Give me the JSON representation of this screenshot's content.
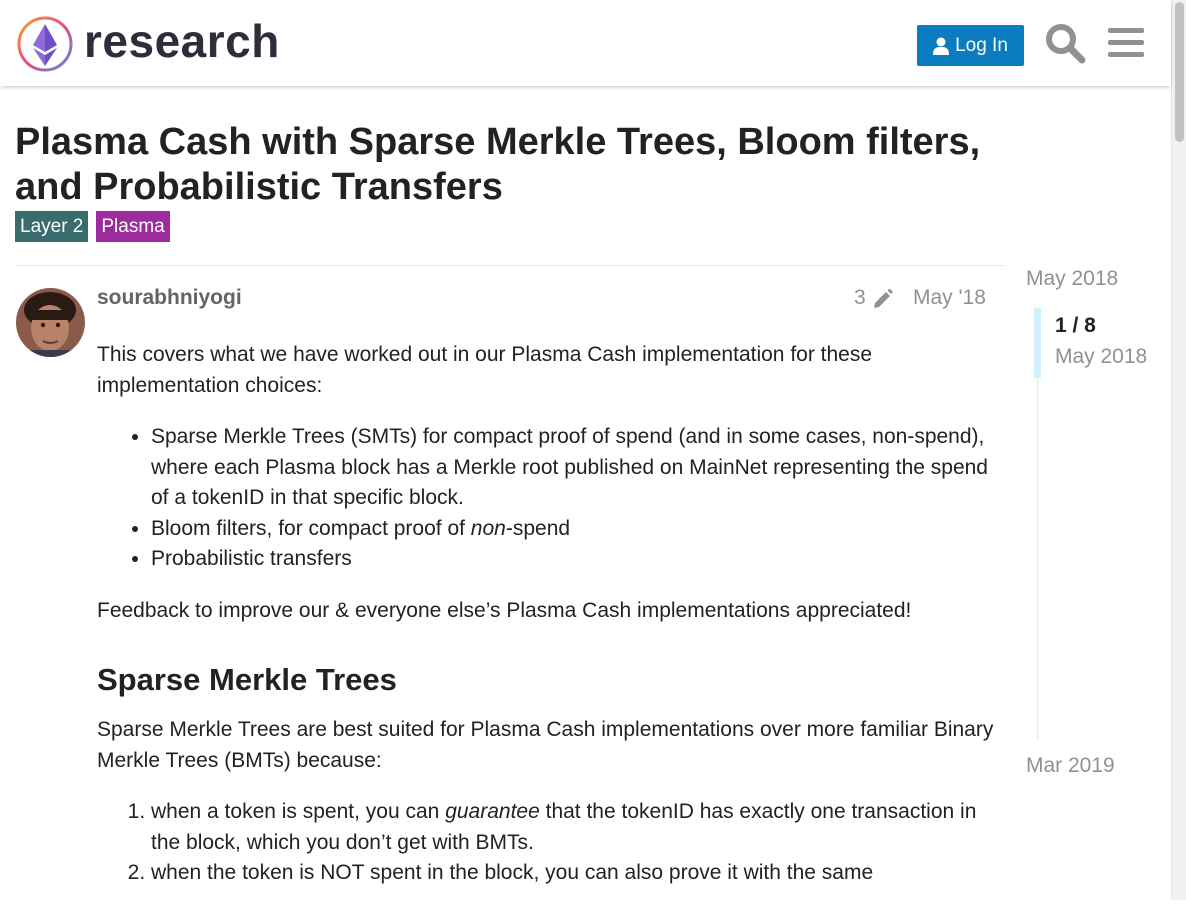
{
  "header": {
    "logo_text": "research",
    "login_label": "Log In",
    "icons": [
      "search-icon",
      "hamburger-menu-icon"
    ]
  },
  "topic": {
    "title": "Plasma Cash with Sparse Merkle Trees, Bloom filters, and Probabilistic Transfers",
    "tags": [
      {
        "label": "Layer 2",
        "color": "#3b6c6d"
      },
      {
        "label": "Plasma",
        "color": "#9e2b9e"
      }
    ]
  },
  "post": {
    "username": "sourabhniyogi",
    "edit_count": "3",
    "date": "May '18",
    "intro": "This covers what we have worked out in our Plasma Cash implementation for these implementation choices:",
    "bullets": [
      {
        "pre": "Sparse Merkle Trees (SMTs) for compact proof of spend (and in some cases, non-spend), where each Plasma block has a Merkle root published on MainNet representing the spend of a tokenID in that specific block.",
        "em": "",
        "post": ""
      },
      {
        "pre": "Bloom filters, for compact proof of ",
        "em": "non",
        "post": "-spend"
      },
      {
        "pre": "Probabilistic transfers",
        "em": "",
        "post": ""
      }
    ],
    "feedback": "Feedback to improve our & everyone else’s Plasma Cash implementations appreciated!",
    "section_heading": "Sparse Merkle Trees",
    "section_intro": "Sparse Merkle Trees are best suited for Plasma Cash implementations over more familiar Binary Merkle Trees (BMTs) because:",
    "numbered": [
      {
        "pre": "when a token is spent, you can ",
        "em": "guarantee",
        "post": " that the tokenID has exactly one transaction in the block, which you don’t get with BMTs."
      },
      {
        "pre": "when the token is NOT spent in the block, you can also prove it with the same",
        "em": "",
        "post": ""
      }
    ]
  },
  "timeline": {
    "start_date": "May 2018",
    "position": "1 / 8",
    "current_date": "May 2018",
    "end_date": "Mar 2019",
    "progress": 0.125
  }
}
